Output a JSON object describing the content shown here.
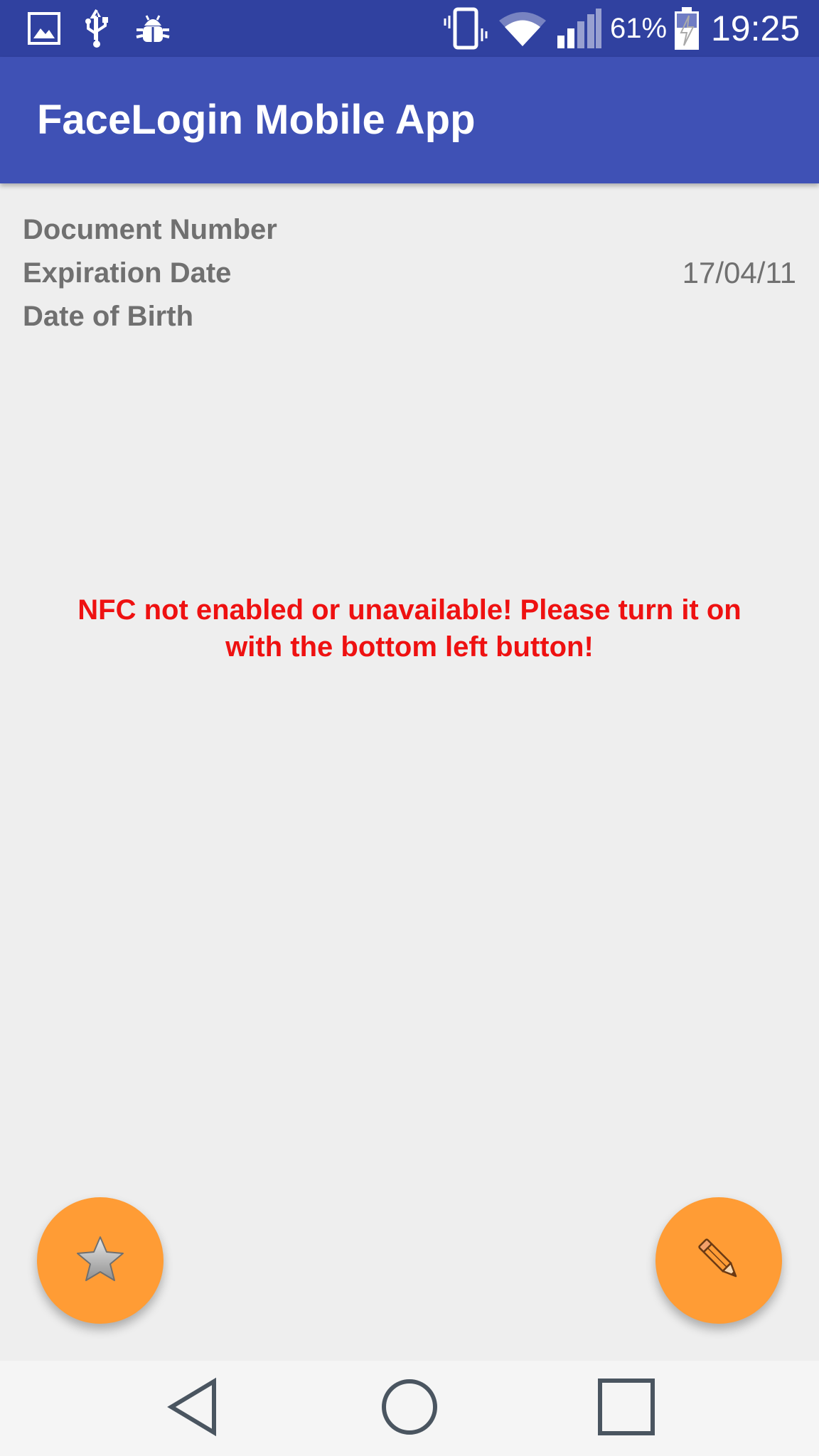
{
  "status_bar": {
    "battery_percent": "61%",
    "time": "19:25",
    "left_icons": [
      "gallery-icon",
      "usb-icon",
      "debug-bug-icon"
    ],
    "right_icons": [
      "vibrate-icon",
      "wifi-icon",
      "signal-icon",
      "battery-charging-icon"
    ]
  },
  "app_bar": {
    "title": "FaceLogin Mobile App"
  },
  "document": {
    "fields": [
      {
        "label": "Document Number",
        "value": ""
      },
      {
        "label": "Expiration Date",
        "value": "17/04/11"
      },
      {
        "label": "Date of Birth",
        "value": ""
      }
    ]
  },
  "message": {
    "text": "NFC not enabled or unavailable! Please turn it on with the bottom left button!"
  },
  "fabs": {
    "left_icon": "star-icon",
    "right_icon": "pencil-icon"
  },
  "nav_bar": {
    "buttons": [
      "back-icon",
      "home-icon",
      "recents-icon"
    ]
  },
  "colors": {
    "status_bar": "#3041a0",
    "app_bar": "#3f51b5",
    "background": "#eeeeee",
    "label_text": "#707070",
    "message_text": "#ee1111",
    "fab": "#ff9c35",
    "nav_bar": "#f5f5f5"
  }
}
